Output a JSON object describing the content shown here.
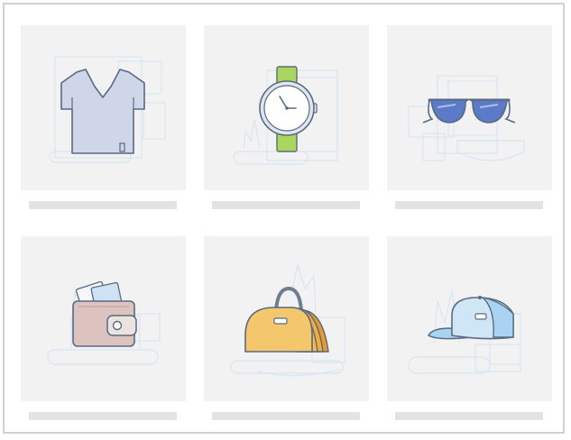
{
  "grid": {
    "products": [
      {
        "icon": "t-shirt-icon",
        "caption": "",
        "color": "#cfd6ea"
      },
      {
        "icon": "wristwatch-icon",
        "caption": "",
        "color": "#a9d75e"
      },
      {
        "icon": "sunglasses-icon",
        "caption": "",
        "color": "#5b7bc8"
      },
      {
        "icon": "wallet-icon",
        "caption": "",
        "color": "#dcc3bf"
      },
      {
        "icon": "duffel-bag-icon",
        "caption": "",
        "color": "#f4c76c"
      },
      {
        "icon": "baseball-cap-icon",
        "caption": "",
        "color": "#a9d3f0"
      }
    ]
  },
  "colors": {
    "tile_background": "#f2f2f2",
    "caption_placeholder": "#e3e3e6",
    "outline": "#5a6a82",
    "sketch": "#d7e6f2"
  }
}
